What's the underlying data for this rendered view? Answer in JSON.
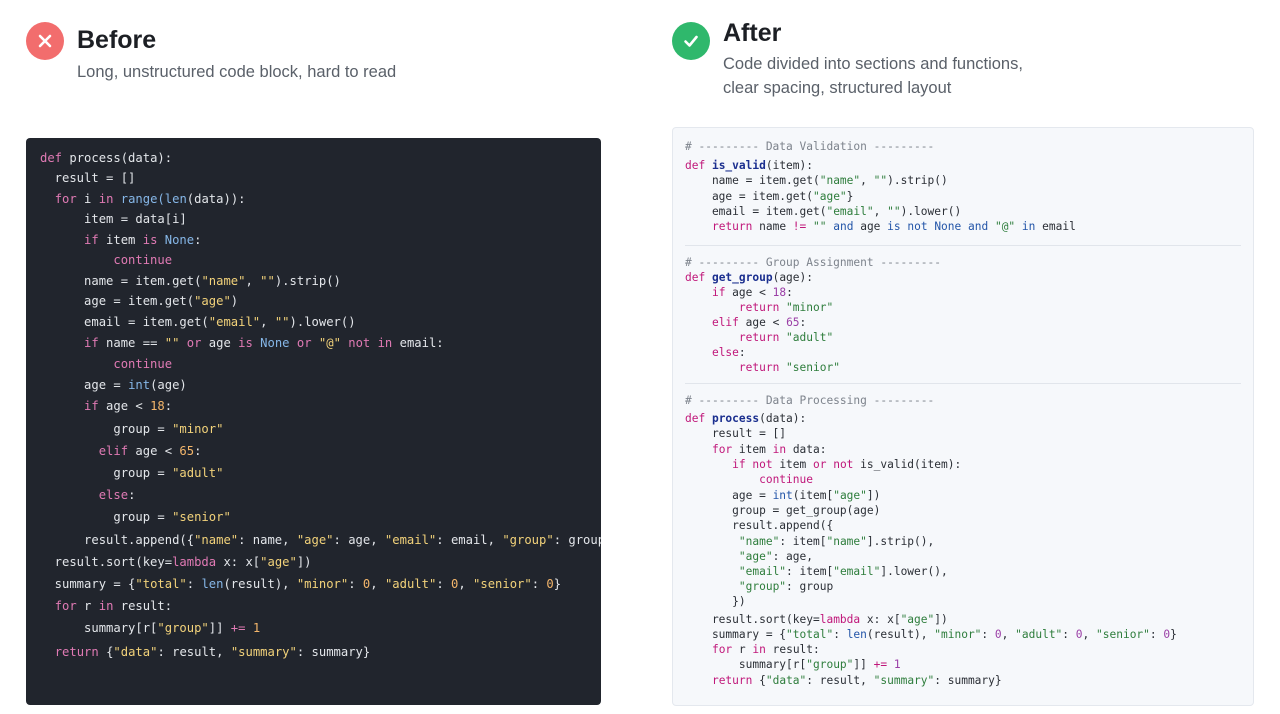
{
  "before": {
    "title": "Before",
    "subtitle": "Long, unstructured code block, hard to read",
    "status_color": "#f26d6d",
    "icon": "x-icon"
  },
  "after": {
    "title": "After",
    "subtitle_line1": "Code divided into sections and functions,",
    "subtitle_line2": "clear spacing, structured layout",
    "status_color": "#2fb86c",
    "icon": "check-icon"
  },
  "colors": {
    "dark_bg": "#21252d",
    "light_bg": "#f6f8fb"
  },
  "before_code": [
    [
      {
        "t": "def ",
        "c": "kw"
      },
      {
        "t": "process(data):"
      }
    ],
    [
      {
        "t": "  result = []"
      }
    ],
    [
      {
        "t": "  "
      },
      {
        "t": "for ",
        "c": "kw"
      },
      {
        "t": "i "
      },
      {
        "t": "in ",
        "c": "kw"
      },
      {
        "t": "range(",
        "c": "bi"
      },
      {
        "t": "len",
        "c": "bi"
      },
      {
        "t": "(data)):"
      }
    ],
    [
      {
        "t": "      item = data[i]"
      }
    ],
    [
      {
        "t": "      "
      },
      {
        "t": "if ",
        "c": "kw"
      },
      {
        "t": "item "
      },
      {
        "t": "is ",
        "c": "kw"
      },
      {
        "t": "None",
        "c": "cn"
      },
      {
        "t": ":"
      }
    ],
    [
      {
        "t": "          "
      },
      {
        "t": "continue",
        "c": "kw"
      }
    ],
    [
      {
        "t": "      name = item.get("
      },
      {
        "t": "\"name\"",
        "c": "st"
      },
      {
        "t": ", "
      },
      {
        "t": "\"\"",
        "c": "st"
      },
      {
        "t": ").strip()"
      }
    ],
    [
      {
        "t": "      age = item.get("
      },
      {
        "t": "\"age\"",
        "c": "st"
      },
      {
        "t": ")"
      }
    ],
    [
      {
        "t": "      email = item.get("
      },
      {
        "t": "\"email\"",
        "c": "st"
      },
      {
        "t": ", "
      },
      {
        "t": "\"\"",
        "c": "st"
      },
      {
        "t": ").lower()"
      }
    ],
    [
      {
        "t": "      "
      },
      {
        "t": "if ",
        "c": "kw"
      },
      {
        "t": "name == "
      },
      {
        "t": "\"\"",
        "c": "st"
      },
      {
        "t": " "
      },
      {
        "t": "or ",
        "c": "kw"
      },
      {
        "t": "age "
      },
      {
        "t": "is ",
        "c": "kw"
      },
      {
        "t": "None",
        "c": "cn"
      },
      {
        "t": " "
      },
      {
        "t": "or ",
        "c": "kw"
      },
      {
        "t": "\"@\"",
        "c": "st"
      },
      {
        "t": " "
      },
      {
        "t": "not in ",
        "c": "kw"
      },
      {
        "t": "email:"
      }
    ],
    [
      {
        "t": "          "
      },
      {
        "t": "continue",
        "c": "kw"
      }
    ],
    [
      {
        "t": "      age = "
      },
      {
        "t": "int",
        "c": "bi"
      },
      {
        "t": "(age)"
      }
    ],
    [
      {
        "t": "      "
      },
      {
        "t": "if ",
        "c": "kw"
      },
      {
        "t": "age < "
      },
      {
        "t": "18",
        "c": "nm"
      },
      {
        "t": ":"
      }
    ],
    [
      {
        "t": "          group = "
      },
      {
        "t": "\"minor\"",
        "c": "st"
      }
    ],
    [
      {
        "t": "        "
      },
      {
        "t": "elif ",
        "c": "kw"
      },
      {
        "t": "age < "
      },
      {
        "t": "65",
        "c": "nm"
      },
      {
        "t": ":"
      }
    ],
    [
      {
        "t": "          group = "
      },
      {
        "t": "\"adult\"",
        "c": "st"
      }
    ],
    [
      {
        "t": "        "
      },
      {
        "t": "else",
        "c": "kw"
      },
      {
        "t": ":"
      }
    ],
    [
      {
        "t": "          group = "
      },
      {
        "t": "\"senior\"",
        "c": "st"
      }
    ],
    [
      {
        "t": "      result.append({"
      },
      {
        "t": "\"name\"",
        "c": "st"
      },
      {
        "t": ": name, "
      },
      {
        "t": "\"age\"",
        "c": "st"
      },
      {
        "t": ": age, "
      },
      {
        "t": "\"email\"",
        "c": "st"
      },
      {
        "t": ": email, "
      },
      {
        "t": "\"group\"",
        "c": "st"
      },
      {
        "t": ": group})"
      }
    ],
    [
      {
        "t": "  result.sort(key="
      },
      {
        "t": "lambda ",
        "c": "kw"
      },
      {
        "t": "x: x["
      },
      {
        "t": "\"age\"",
        "c": "st"
      },
      {
        "t": "])"
      }
    ],
    [
      {
        "t": "  summary = {"
      },
      {
        "t": "\"total\"",
        "c": "st"
      },
      {
        "t": ": "
      },
      {
        "t": "len",
        "c": "bi"
      },
      {
        "t": "(result), "
      },
      {
        "t": "\"minor\"",
        "c": "st"
      },
      {
        "t": ": "
      },
      {
        "t": "0",
        "c": "nm"
      },
      {
        "t": ", "
      },
      {
        "t": "\"adult\"",
        "c": "st"
      },
      {
        "t": ": "
      },
      {
        "t": "0",
        "c": "nm"
      },
      {
        "t": ", "
      },
      {
        "t": "\"senior\"",
        "c": "st"
      },
      {
        "t": ": "
      },
      {
        "t": "0",
        "c": "nm"
      },
      {
        "t": "}"
      }
    ],
    [
      {
        "t": "  "
      },
      {
        "t": "for ",
        "c": "kw"
      },
      {
        "t": "r "
      },
      {
        "t": "in ",
        "c": "kw"
      },
      {
        "t": "result:"
      }
    ],
    [
      {
        "t": "      summary[r["
      },
      {
        "t": "\"group\"",
        "c": "st"
      },
      {
        "t": "]] "
      },
      {
        "t": "+=",
        "c": "kw"
      },
      {
        "t": " "
      },
      {
        "t": "1",
        "c": "nm"
      }
    ],
    [
      {
        "t": "  "
      },
      {
        "t": "return ",
        "c": "kw"
      },
      {
        "t": "{"
      },
      {
        "t": "\"data\"",
        "c": "st"
      },
      {
        "t": ": result, "
      },
      {
        "t": "\"summary\"",
        "c": "st"
      },
      {
        "t": ": summary}"
      }
    ]
  ],
  "after_code": [
    [
      {
        "t": "# --------- Data Validation ---------",
        "c": "cm"
      }
    ],
    [
      {
        "t": "def ",
        "c": "kw"
      },
      {
        "t": "is_valid",
        "c": "fn"
      },
      {
        "t": "(item):"
      }
    ],
    [
      {
        "t": "    name = item.get("
      },
      {
        "t": "\"name\"",
        "c": "st"
      },
      {
        "t": ", "
      },
      {
        "t": "\"\"",
        "c": "st"
      },
      {
        "t": ").strip()"
      }
    ],
    [
      {
        "t": "    age = item.get("
      },
      {
        "t": "\"age\"",
        "c": "st"
      },
      {
        "t": "}"
      }
    ],
    [
      {
        "t": "    email = item.get("
      },
      {
        "t": "\"email\"",
        "c": "st"
      },
      {
        "t": ", "
      },
      {
        "t": "\"\"",
        "c": "st"
      },
      {
        "t": ").lower()"
      }
    ],
    [
      {
        "t": "    "
      },
      {
        "t": "return ",
        "c": "kw"
      },
      {
        "t": "name "
      },
      {
        "t": "!= ",
        "c": "kw"
      },
      {
        "t": "\"\"",
        "c": "st"
      },
      {
        "t": " "
      },
      {
        "t": "and ",
        "c": "cn"
      },
      {
        "t": "age "
      },
      {
        "t": "is not ",
        "c": "cn"
      },
      {
        "t": "None ",
        "c": "cn"
      },
      {
        "t": "and ",
        "c": "cn"
      },
      {
        "t": "\"@\"",
        "c": "st"
      },
      {
        "t": " "
      },
      {
        "t": "in ",
        "c": "cn"
      },
      {
        "t": "email"
      }
    ],
    [
      {
        "t": "# --------- Group Assignment ---------",
        "c": "cm"
      }
    ],
    [
      {
        "t": "def ",
        "c": "kw"
      },
      {
        "t": "get_group",
        "c": "fn"
      },
      {
        "t": "(age):"
      }
    ],
    [
      {
        "t": "    "
      },
      {
        "t": "if ",
        "c": "kw"
      },
      {
        "t": "age < "
      },
      {
        "t": "18",
        "c": "nm"
      },
      {
        "t": ":"
      }
    ],
    [
      {
        "t": "        "
      },
      {
        "t": "return ",
        "c": "kw"
      },
      {
        "t": "\"minor\"",
        "c": "st"
      }
    ],
    [
      {
        "t": "    "
      },
      {
        "t": "elif ",
        "c": "kw"
      },
      {
        "t": "age < "
      },
      {
        "t": "65",
        "c": "nm"
      },
      {
        "t": ":"
      }
    ],
    [
      {
        "t": "        "
      },
      {
        "t": "return ",
        "c": "kw"
      },
      {
        "t": "\"adult\"",
        "c": "st"
      }
    ],
    [
      {
        "t": "    "
      },
      {
        "t": "else",
        "c": "kw"
      },
      {
        "t": ":"
      }
    ],
    [
      {
        "t": "        "
      },
      {
        "t": "return ",
        "c": "kw"
      },
      {
        "t": "\"senior\"",
        "c": "st"
      }
    ],
    [
      {
        "t": "# --------- Data Processing ---------",
        "c": "cm"
      }
    ],
    [
      {
        "t": "def ",
        "c": "kw"
      },
      {
        "t": "process",
        "c": "fn"
      },
      {
        "t": "(data):"
      }
    ],
    [
      {
        "t": "    result = []"
      }
    ],
    [
      {
        "t": "    "
      },
      {
        "t": "for ",
        "c": "kw"
      },
      {
        "t": "item "
      },
      {
        "t": "in ",
        "c": "kw"
      },
      {
        "t": "data:"
      }
    ],
    [
      {
        "t": "       "
      },
      {
        "t": "if not ",
        "c": "kw"
      },
      {
        "t": "item "
      },
      {
        "t": "or not ",
        "c": "kw"
      },
      {
        "t": "is_valid(item):"
      }
    ],
    [
      {
        "t": "           "
      },
      {
        "t": "continue",
        "c": "kw"
      }
    ],
    [
      {
        "t": "       age = "
      },
      {
        "t": "int",
        "c": "bi"
      },
      {
        "t": "(item["
      },
      {
        "t": "\"age\"",
        "c": "st"
      },
      {
        "t": "])"
      }
    ],
    [
      {
        "t": "       group = get_group(age)"
      }
    ],
    [
      {
        "t": "       result.append({"
      }
    ],
    [
      {
        "t": "        "
      },
      {
        "t": "\"name\"",
        "c": "st"
      },
      {
        "t": ": item["
      },
      {
        "t": "\"name\"",
        "c": "st"
      },
      {
        "t": "].strip(),"
      }
    ],
    [
      {
        "t": "        "
      },
      {
        "t": "\"age\"",
        "c": "st"
      },
      {
        "t": ": age,"
      }
    ],
    [
      {
        "t": "        "
      },
      {
        "t": "\"email\"",
        "c": "st"
      },
      {
        "t": ": item["
      },
      {
        "t": "\"email\"",
        "c": "st"
      },
      {
        "t": "].lower(),"
      }
    ],
    [
      {
        "t": "        "
      },
      {
        "t": "\"group\"",
        "c": "st"
      },
      {
        "t": ": group"
      }
    ],
    [
      {
        "t": "       })"
      }
    ],
    [
      {
        "t": "    result.sort(key="
      },
      {
        "t": "lambda ",
        "c": "kw"
      },
      {
        "t": "x: x["
      },
      {
        "t": "\"age\"",
        "c": "st"
      },
      {
        "t": "])"
      }
    ],
    [
      {
        "t": "    summary = {"
      },
      {
        "t": "\"total\"",
        "c": "st"
      },
      {
        "t": ": "
      },
      {
        "t": "len",
        "c": "bi"
      },
      {
        "t": "(result), "
      },
      {
        "t": "\"minor\"",
        "c": "st"
      },
      {
        "t": ": "
      },
      {
        "t": "0",
        "c": "nm"
      },
      {
        "t": ", "
      },
      {
        "t": "\"adult\"",
        "c": "st"
      },
      {
        "t": ": "
      },
      {
        "t": "0",
        "c": "nm"
      },
      {
        "t": ", "
      },
      {
        "t": "\"senior\"",
        "c": "st"
      },
      {
        "t": ": "
      },
      {
        "t": "0",
        "c": "nm"
      },
      {
        "t": "}"
      }
    ],
    [
      {
        "t": "    "
      },
      {
        "t": "for ",
        "c": "kw"
      },
      {
        "t": "r "
      },
      {
        "t": "in ",
        "c": "kw"
      },
      {
        "t": "result:"
      }
    ],
    [
      {
        "t": "        summary[r["
      },
      {
        "t": "\"group\"",
        "c": "st"
      },
      {
        "t": "]] "
      },
      {
        "t": "+=",
        "c": "kw"
      },
      {
        "t": " "
      },
      {
        "t": "1",
        "c": "nm"
      }
    ],
    [
      {
        "t": "    "
      },
      {
        "t": "return ",
        "c": "kw"
      },
      {
        "t": "{"
      },
      {
        "t": "\"data\"",
        "c": "st"
      },
      {
        "t": ": result, "
      },
      {
        "t": "\"summary\"",
        "c": "st"
      },
      {
        "t": ": summary}"
      }
    ]
  ]
}
